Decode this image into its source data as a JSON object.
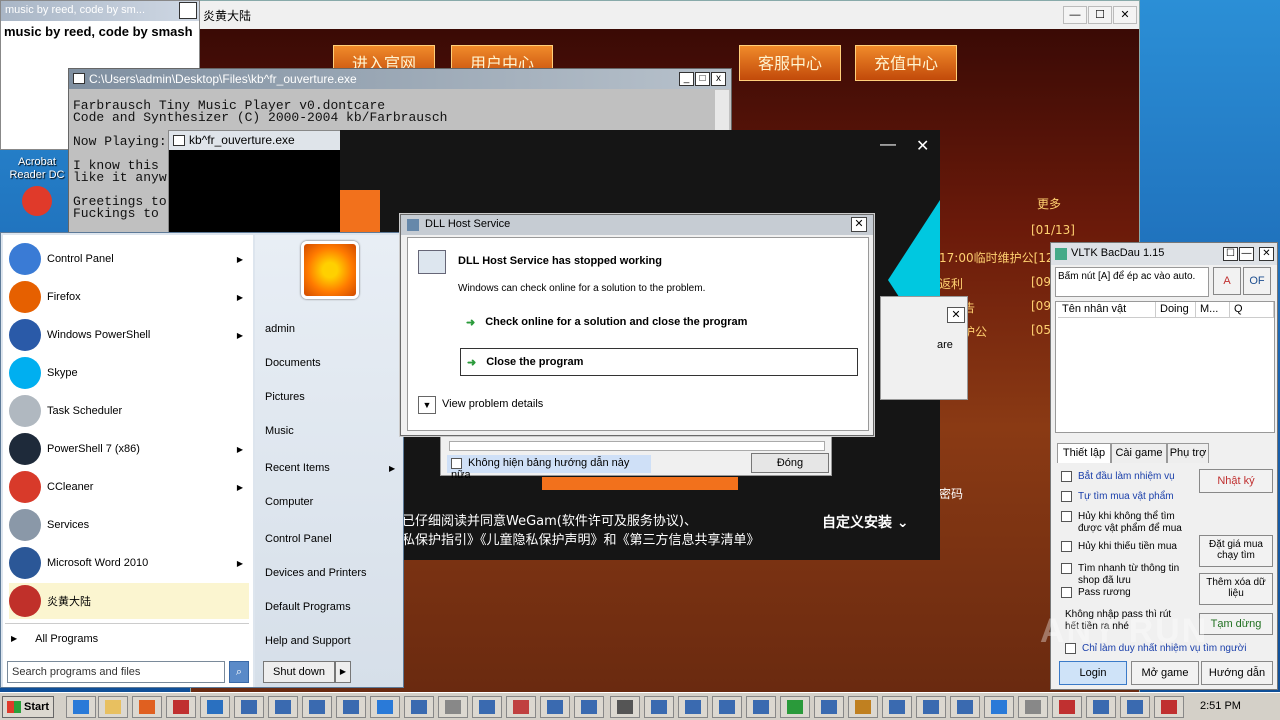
{
  "note_window": {
    "title": "music by reed, code by sm...",
    "close": "✕",
    "text": "music by reed, code by smash"
  },
  "game_window": {
    "title": "炎黄大陆",
    "min": "—",
    "max": "☐",
    "close": "✕",
    "buttons": [
      "进入官网",
      "用户中心",
      "客服中心",
      "充值中心"
    ],
    "more": "更多",
    "news": [
      "[01/13]",
      "17:00临时维护公[12",
      "返利",
      "[09",
      "新公告",
      "[09",
      "急维护公",
      "[05"
    ],
    "password_link": "密码"
  },
  "desktop_icons": [
    {
      "label": "Acrobat Reader DC"
    }
  ],
  "console1": {
    "title": "C:\\Users\\admin\\Desktop\\Files\\kb^fr_ouverture.exe",
    "text": "Farbrausch Tiny Music Player v0.dontcare\nCode and Synthesizer (C) 2000-2004 kb/Farbrausch\n\nNow Playing:\n\nI know this\nlike it anyw\n\nGreetings to\nFuckings to"
  },
  "console2": {
    "title": "kb^fr_ouverture.exe"
  },
  "installer": {
    "min": "—",
    "close": "✕",
    "custom_install": "自定义安装",
    "agreement_line1": "已仔细阅读并同意WeGam(软件许可及服务协议)、",
    "agreement_line2": "私保护指引》《儿童隐私保护声明》和《第三方信息共享清单》",
    "hide_checkbox": "Không hiện bảng hướng dẫn này nữa",
    "close_btn": "Đóng",
    "side_text": "are"
  },
  "start_menu": {
    "programs": [
      {
        "label": "Control Panel",
        "arrow": true,
        "color": "#3a7bd5"
      },
      {
        "label": "Firefox",
        "arrow": true,
        "color": "#e66000"
      },
      {
        "label": "Windows PowerShell",
        "arrow": true,
        "color": "#2a5aa8"
      },
      {
        "label": "Skype",
        "arrow": false,
        "color": "#00aff0"
      },
      {
        "label": "Task Scheduler",
        "arrow": false,
        "color": "#b0b8c0"
      },
      {
        "label": "PowerShell 7 (x86)",
        "arrow": true,
        "color": "#1e2a3a"
      },
      {
        "label": "CCleaner",
        "arrow": true,
        "color": "#d83a2a"
      },
      {
        "label": "Services",
        "arrow": false,
        "color": "#8a98a8"
      },
      {
        "label": "Microsoft Word 2010",
        "arrow": true,
        "color": "#2b5797"
      },
      {
        "label": "炎黄大陆",
        "arrow": false,
        "color": "#c0302a"
      }
    ],
    "all_programs": "All Programs",
    "search_placeholder": "Search programs and files",
    "right_items": [
      "admin",
      "Documents",
      "Pictures",
      "Music",
      "Recent Items",
      "Computer",
      "Control Panel",
      "Devices and Printers",
      "Default Programs",
      "Help and Support"
    ],
    "shutdown": "Shut down"
  },
  "dll_dialog": {
    "title": "DLL Host Service",
    "heading": "DLL Host Service has stopped working",
    "subtext": "Windows can check online for a solution to the problem.",
    "option1": "Check online for a solution and close the program",
    "option2": "Close the program",
    "details": "View problem details",
    "close": "✕"
  },
  "small_dialog": {
    "close": "✕"
  },
  "vltk": {
    "title": "VLTK BacDau 1.15",
    "hint": "Bấm nút [A] để ép ac vào auto.",
    "btn_a": "A",
    "btn_of": "OF",
    "columns": [
      "Tên nhân vật",
      "Doing",
      "M...",
      "Q"
    ],
    "tabs": [
      "Thiết lập",
      "Cài game",
      "Phụ trợ"
    ],
    "options": [
      "Bắt đầu làm nhiệm vụ",
      "Tự tìm mua vật phẩm",
      "Hủy khi không thể tìm được vật phẩm để mua",
      "Hủy khi thiếu tiền mua",
      "Tìm nhanh từ thông tin shop đã lưu",
      "Pass rương"
    ],
    "no_pass_note": "Không nhập pass thì rút hết tiền ra nhé",
    "last_option": "Chỉ làm duy nhất nhiệm vụ tìm người",
    "btn_log": "Nhật ký",
    "btn_bid": "Đặt giá mua chạy tìm",
    "btn_clear": "Thêm xóa dữ liệu",
    "btn_pause": "Tạm dừng",
    "btn_login": "Login",
    "btn_open": "Mở game",
    "btn_help": "Hướng dẫn",
    "min": "—",
    "max": "☐",
    "close": "✕"
  },
  "taskbar": {
    "start": "Start",
    "clock": "2:51 PM"
  },
  "watermark": "ANY RUN"
}
